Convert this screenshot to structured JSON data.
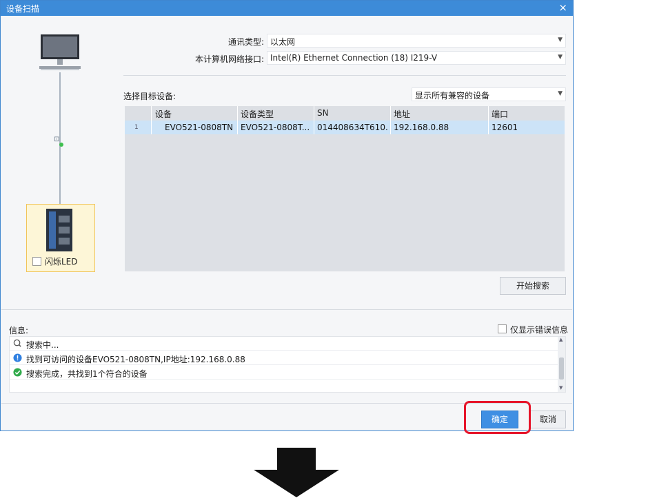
{
  "window": {
    "title": "设备扫描",
    "close_glyph": "×"
  },
  "form": {
    "comm_type_label": "通讯类型:",
    "comm_type_value": "以太网",
    "nic_label": "本计算机网络接口:",
    "nic_value": "Intel(R) Ethernet Connection (18) I219-V",
    "target_label": "选择目标设备:",
    "filter_value": "显示所有兼容的设备"
  },
  "table": {
    "columns": [
      "设备",
      "设备类型",
      "SN",
      "地址",
      "端口"
    ],
    "rows": [
      {
        "index": "1",
        "device": "EVO521-0808TN",
        "type": "EVO521-0808T...",
        "sn": "014408634T610...",
        "address": "192.168.0.88",
        "port": "12601"
      }
    ]
  },
  "left": {
    "led_label": "闪烁LED"
  },
  "buttons": {
    "start_search": "开始搜索",
    "ok": "确定",
    "cancel": "取消"
  },
  "info": {
    "label": "信息:",
    "only_errors_label": "仅显示错误信息",
    "logs": [
      {
        "icon": "search-icon",
        "text": "搜索中..."
      },
      {
        "icon": "info-icon",
        "text": "找到可访问的设备EVO521-0808TN,IP地址:192.168.0.88"
      },
      {
        "icon": "check-circle-icon",
        "text": "搜索完成，共找到1个符合的设备"
      }
    ]
  },
  "colors": {
    "titlebar": "#3d8bd8",
    "primary": "#3f8fe3",
    "highlight": "#e6152a",
    "selected_row": "#cce3f7"
  }
}
